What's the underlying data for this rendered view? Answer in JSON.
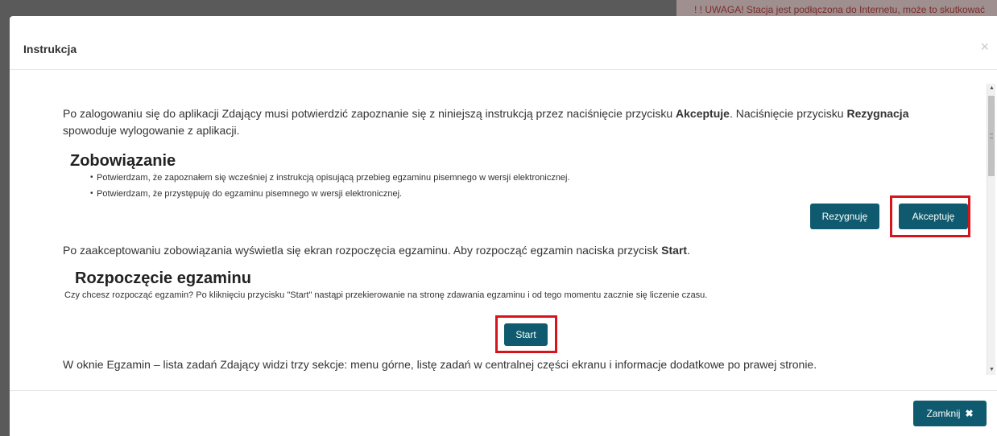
{
  "backdrop": {
    "warning_text": "! ! UWAGA! Stacja jest podłączona do Internetu, może to skutkować"
  },
  "modal": {
    "title": "Instrukcja",
    "close_icon": "×",
    "body": {
      "intro_before_accept": "Po zalogowaniu się do aplikacji Zdający musi potwierdzić zapoznanie się z niniejszą instrukcją przez naciśnięcie przycisku ",
      "accept_word": "Akceptuje",
      "intro_middle": ". Naciśnięcie przycisku ",
      "reject_word": "Rezygnacja",
      "intro_after": " spowoduje wylogowanie z aplikacji.",
      "commitment_heading": "Zobowiązanie",
      "commitment_items": [
        "Potwierdzam, że zapoznałem się wcześniej z instrukcją opisującą przebieg egzaminu pisemnego w wersji elektronicznej.",
        "Potwierdzam, że przystępuję do egzaminu pisemnego w wersji elektronicznej."
      ],
      "reject_button": "Rezygnuję",
      "accept_button": "Akceptuję",
      "after_accept_before": "Po zaakceptowaniu zobowiązania wyświetla się ekran rozpoczęcia egzaminu. Aby rozpocząć egzamin naciska przycisk ",
      "start_word": "Start",
      "after_accept_after": ".",
      "start_heading": "Rozpoczęcie egzaminu",
      "start_question": "Czy chcesz rozpocząć egzamin? Po kliknięciu przycisku \"Start\" nastąpi przekierowanie na stronę zdawania egzaminu i od tego momentu zacznie się liczenie czasu.",
      "start_button": "Start",
      "exam_window_text": "W oknie Egzamin – lista zadań Zdający widzi trzy sekcje: menu górne, listę zadań w centralnej części ekranu i informacje dodatkowe po prawej stronie."
    },
    "footer": {
      "close_button": "Zamknij",
      "close_button_icon": "✖"
    }
  },
  "colors": {
    "primary_button": "#0f5a6e",
    "highlight": "#d8141b"
  },
  "icons": [
    "close-icon",
    "times-icon",
    "scroll-up-arrow-icon",
    "scroll-down-arrow-icon"
  ]
}
